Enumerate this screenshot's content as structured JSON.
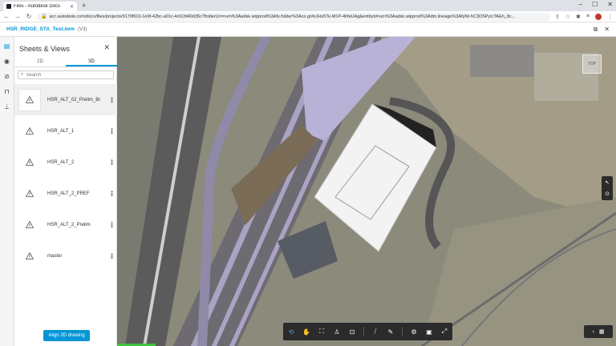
{
  "browser": {
    "tab_title": "Files - Autodesk Docs",
    "url": "acc.autodesk.com/docs/files/projects/9179f610-1e9f-42bc-a01c-4c61fd49d35c?folderUrn=urn%3Aadsk.wipprod%3Afs.folder%3Aco.gnfeJHs5Te-M1P-4hfeUAg&entityId=urn%3Aadsk.wipprod%3Adm.lineage%3AfyNt-hC3OSPyIcTAEh_8c..."
  },
  "header": {
    "file_name": "HSR_RIDGE_STA_Test.iwm",
    "version": "(V3)"
  },
  "panel": {
    "title": "Sheets & Views",
    "tabs": [
      "2D",
      "3D"
    ],
    "active_tab": "3D",
    "search_placeholder": "Search",
    "items": [
      {
        "name": "HSR_ALT_02_Prelim_Br"
      },
      {
        "name": "HSR_ALT_1"
      },
      {
        "name": "HSR_ALT_2"
      },
      {
        "name": "HSR_ALT_2_PREF"
      },
      {
        "name": "HSR_ALT_2_Prelim"
      },
      {
        "name": "master"
      }
    ],
    "align_button": "Align 2D drawing"
  },
  "viewer": {
    "viewcube_label": "TOP"
  },
  "colors": {
    "accent": "#0696d7",
    "toolbar_bg": "#2b2b2b"
  }
}
